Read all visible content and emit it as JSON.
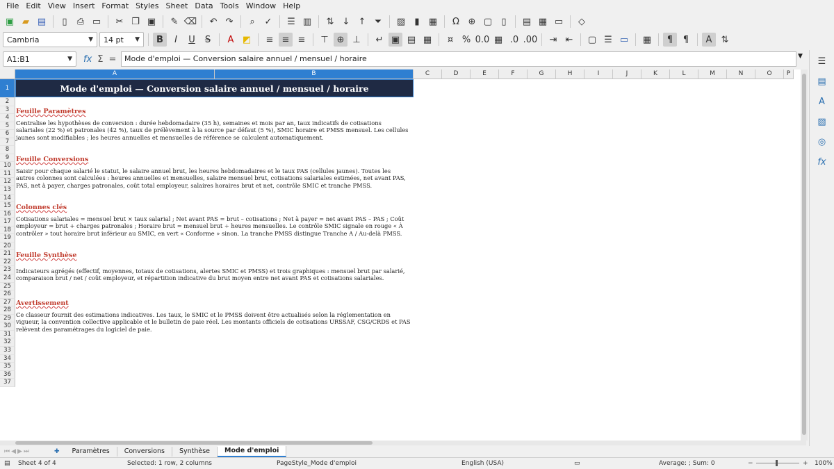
{
  "menu": [
    "File",
    "Edit",
    "View",
    "Insert",
    "Format",
    "Styles",
    "Sheet",
    "Data",
    "Tools",
    "Window",
    "Help"
  ],
  "font": {
    "name": "Cambria",
    "size": "14 pt"
  },
  "formula": {
    "namebox": "A1:B1",
    "content": "Mode d'emploi — Conversion salaire annuel / mensuel / horaire"
  },
  "columns": [
    "A",
    "B",
    "C",
    "D",
    "E",
    "F",
    "G",
    "H",
    "I",
    "J",
    "K",
    "L",
    "M",
    "N",
    "O",
    "P"
  ],
  "rows": [
    "1",
    "2",
    "3",
    "4",
    "5",
    "6",
    "7",
    "8",
    "9",
    "10",
    "11",
    "12",
    "13",
    "14",
    "15",
    "16",
    "17",
    "18",
    "19",
    "20",
    "21",
    "22",
    "23",
    "24",
    "25",
    "26",
    "27",
    "28",
    "29",
    "30",
    "31",
    "32",
    "33",
    "34",
    "35",
    "36",
    "37"
  ],
  "sheet": {
    "title": "Mode d'emploi — Conversion salaire annuel / mensuel / horaire",
    "sections": [
      {
        "heading": "Feuille Paramètres",
        "text": "Centralise les hypothèses de conversion : durée hebdomadaire (35 h), semaines et mois par an, taux indicatifs de cotisations salariales (22 %) et patronales (42 %), taux de prélèvement à la source par défaut (5 %), SMIC horaire et PMSS mensuel. Les cellules jaunes sont modifiables ; les heures annuelles et mensuelles de référence se calculent automatiquement."
      },
      {
        "heading": "Feuille Conversions",
        "text": "Saisir pour chaque salarié le statut, le salaire annuel brut, les heures hebdomadaires et le taux PAS (cellules jaunes). Toutes les autres colonnes sont calculées : heures annuelles et mensuelles, salaire mensuel brut, cotisations salariales estimées, net avant PAS, PAS, net à payer, charges patronales, coût total employeur, salaires horaires brut et net, contrôle SMIC et tranche PMSS."
      },
      {
        "heading": "Colonnes clés",
        "text": "Cotisations salariales = mensuel brut × taux salarial ; Net avant PAS = brut – cotisations ; Net à payer = net avant PAS – PAS ; Coût employeur = brut + charges patronales ; Horaire brut = mensuel brut ÷ heures mensuelles. Le contrôle SMIC signale en rouge « À contrôler » tout horaire brut inférieur au SMIC, en vert « Conforme » sinon. La tranche PMSS distingue Tranche A / Au-delà PMSS."
      },
      {
        "heading": "Feuille Synthèse",
        "text": "Indicateurs agrégés (effectif, moyennes, totaux de cotisations, alertes SMIC et PMSS) et trois graphiques : mensuel brut par salarié, comparaison brut / net / coût employeur, et répartition indicative du brut moyen entre net avant PAS et cotisations salariales."
      },
      {
        "heading": "Avertissement",
        "text": "Ce classeur fournit des estimations indicatives. Les taux, le SMIC et le PMSS doivent être actualisés selon la réglementation en vigueur, la convention collective applicable et le bulletin de paie réel. Les montants officiels de cotisations URSSAF, CSG/CRDS et PAS relèvent des paramétrages du logiciel de paie."
      }
    ]
  },
  "tabs": [
    "Paramètres",
    "Conversions",
    "Synthèse",
    "Mode d'emploi"
  ],
  "status": {
    "sheet": "Sheet 4 of 4",
    "selection": "Selected: 1 row, 2 columns",
    "pagestyle": "PageStyle_Mode d'emploi",
    "language": "English (USA)",
    "aggregate": "Average: ; Sum: 0",
    "zoom": "100%"
  }
}
